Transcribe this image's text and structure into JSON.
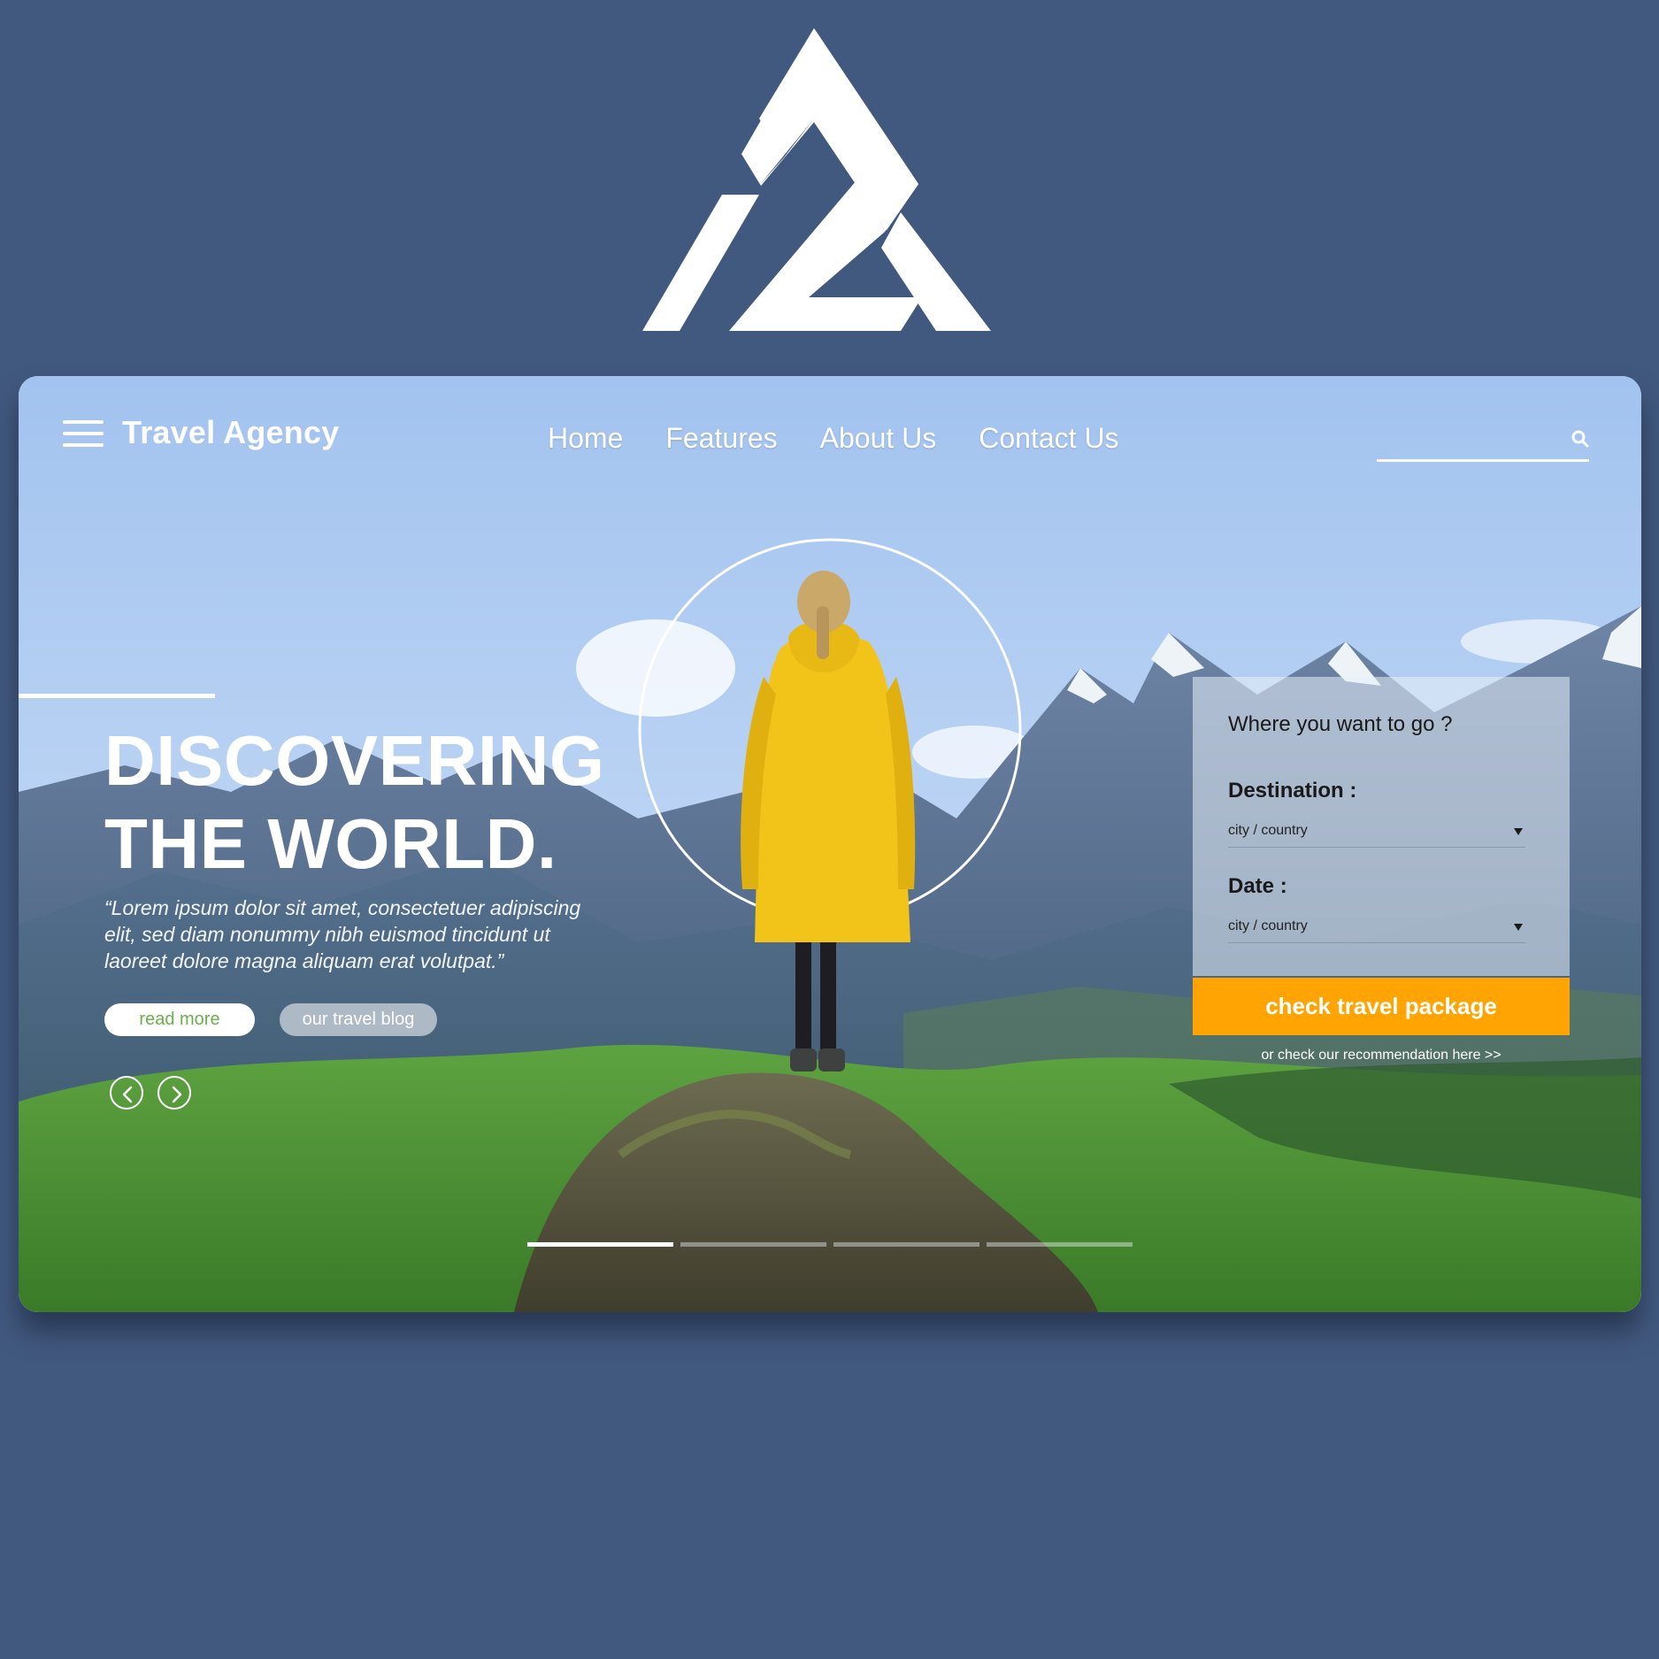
{
  "colors": {
    "page_background": "#42597f",
    "accent_orange": "#ffa402",
    "read_more_green": "#6ab04c",
    "jacket_yellow": "#f2c318"
  },
  "logo": {
    "icon": "triangle-mountain-logo-icon"
  },
  "header": {
    "brand": "Travel Agency",
    "menu_icon": "hamburger-menu-icon",
    "nav": [
      "Home",
      "Features",
      "About Us",
      "Contact Us"
    ],
    "search": {
      "placeholder": "",
      "icon": "search-icon"
    }
  },
  "hero": {
    "headline_line1": "DISCOVERING",
    "headline_line2": "THE WORLD.",
    "quote_line1": "“Lorem ipsum dolor sit amet, consectetuer adipiscing",
    "quote_line2": "elit, sed diam nonummy nibh euismod tincidunt ut",
    "quote_line3": "laoreet dolore magna aliquam erat volutpat.”",
    "read_more": "read more",
    "travel_blog": "our travel blog",
    "prev_icon": "chevron-left-icon",
    "next_icon": "chevron-right-icon"
  },
  "booking": {
    "title": "Where you want to go ?",
    "destination_label": "Destination :",
    "destination_value": "city / country",
    "date_label": "Date :",
    "date_value": "city / country",
    "submit": "check travel package",
    "recommendation": "or check our recommendation here >>"
  },
  "slider": {
    "slides": 4,
    "active_index": 0
  }
}
